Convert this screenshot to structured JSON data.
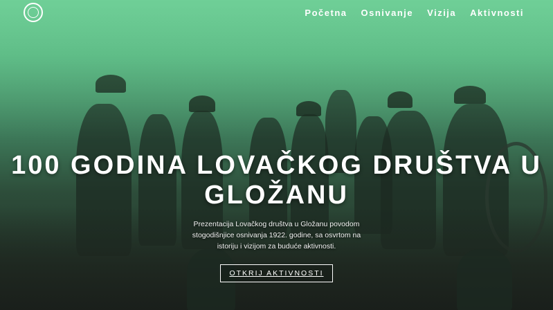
{
  "nav": {
    "items": [
      {
        "label": "Početna"
      },
      {
        "label": "Osnivanje"
      },
      {
        "label": "Vizija"
      },
      {
        "label": "Aktivnosti"
      }
    ]
  },
  "hero": {
    "title": "100 GODINA LOVAČKOG DRUŠTVA U GLOŽANU",
    "subtitle": "Prezentacija Lovačkog društva u Gložanu povodom stogodišnjice osnivanja 1922. godine, sa osvrtom na istoriju i vizijom za buduće aktivnosti.",
    "cta_label": "OTKRIJ AKTIVNOSTI"
  },
  "colors": {
    "accent_green": "#6fcf97",
    "text": "#ffffff"
  }
}
